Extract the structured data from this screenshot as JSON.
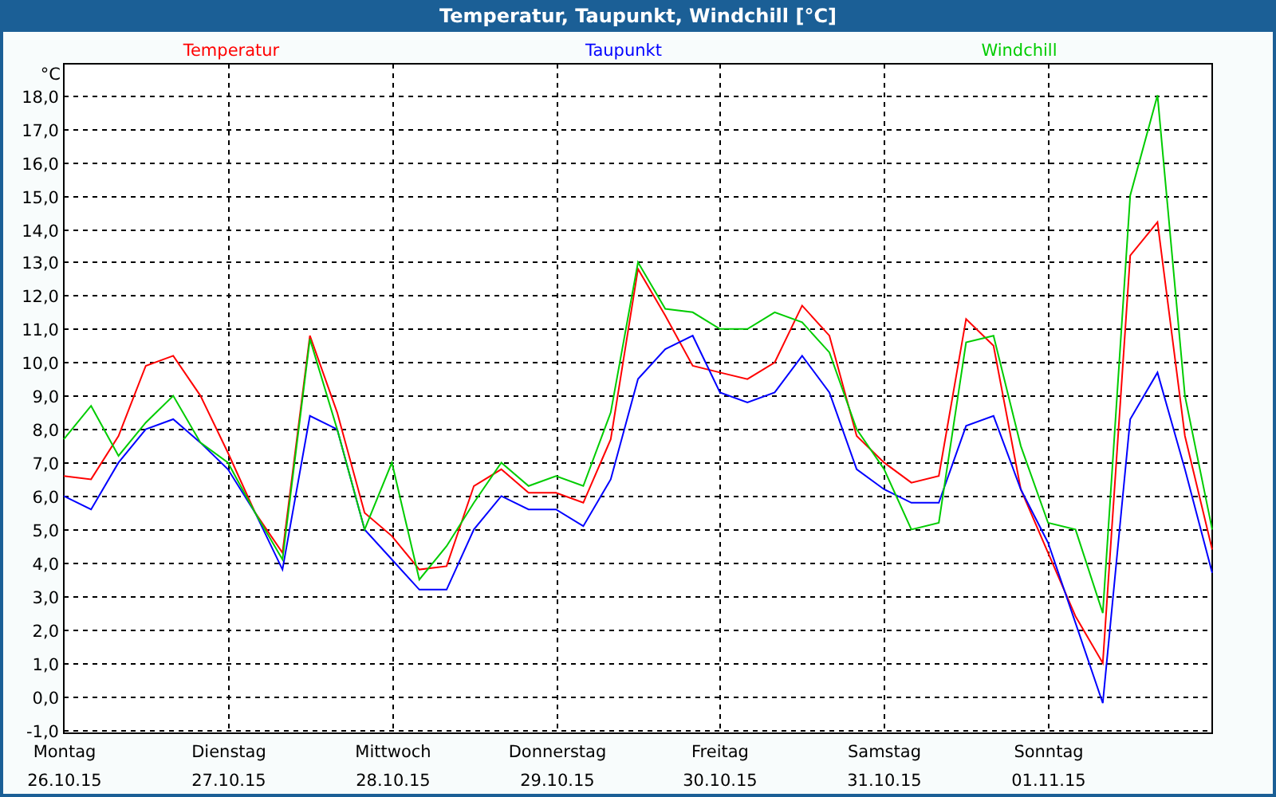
{
  "window": {
    "title": "Temperatur, Taupunkt, Windchill [°C]"
  },
  "chart": {
    "chart_data": {
      "type": "line",
      "ylabel": "°C",
      "categories": [
        "Montag",
        null,
        null,
        null,
        null,
        null,
        "Dienstag",
        null,
        null,
        null,
        null,
        null,
        "Mittwoch",
        null,
        null,
        null,
        null,
        null,
        "Donnerstag",
        null,
        null,
        null,
        null,
        null,
        "Freitag",
        null,
        null,
        null,
        null,
        null,
        "Samstag",
        null,
        null,
        null,
        null,
        null,
        "Sonntag",
        null,
        null,
        null,
        null,
        null,
        null
      ],
      "ylim": [
        -1.1,
        18.94
      ],
      "grid": true,
      "yticks": [
        {
          "value": -1,
          "label": "-1,0"
        },
        {
          "value": 0,
          "label": "0,0"
        },
        {
          "value": 1,
          "label": "1,0"
        },
        {
          "value": 2,
          "label": "2,0"
        },
        {
          "value": 3,
          "label": "3,0"
        },
        {
          "value": 4,
          "label": "4,0"
        },
        {
          "value": 5,
          "label": "5,0"
        },
        {
          "value": 6,
          "label": "6,0"
        },
        {
          "value": 7,
          "label": "7,0"
        },
        {
          "value": 8,
          "label": "8,0"
        },
        {
          "value": 9,
          "label": "9,0"
        },
        {
          "value": 10,
          "label": "10,0"
        },
        {
          "value": 11,
          "label": "11,0"
        },
        {
          "value": 12,
          "label": "12,0"
        },
        {
          "value": 13,
          "label": "13,0"
        },
        {
          "value": 14,
          "label": "14,0"
        },
        {
          "value": 15,
          "label": "15,0"
        },
        {
          "value": 16,
          "label": "16,0"
        },
        {
          "value": 17,
          "label": "17,0"
        },
        {
          "value": 18,
          "label": "18,0"
        }
      ],
      "series": [
        {
          "name": "Temperatur",
          "color": "#ff0000",
          "values": [
            6.6,
            6.5,
            7.8,
            9.9,
            10.2,
            9.0,
            7.3,
            5.5,
            4.3,
            10.8,
            8.5,
            5.5,
            4.8,
            3.8,
            3.9,
            6.3,
            6.8,
            6.1,
            6.1,
            5.8,
            7.7,
            12.8,
            11.4,
            9.9,
            9.7,
            9.5,
            10.0,
            11.7,
            10.8,
            7.8,
            7.0,
            6.4,
            6.6,
            11.3,
            10.5,
            6.2,
            4.3,
            2.4,
            1.0,
            13.2,
            14.2,
            7.8,
            4.4
          ]
        },
        {
          "name": "Taupunkt",
          "color": "#0000ff",
          "values": [
            6.0,
            5.6,
            7.0,
            8.0,
            8.3,
            7.6,
            6.8,
            5.5,
            3.8,
            8.4,
            8.0,
            5.0,
            4.1,
            3.2,
            3.2,
            5.0,
            6.0,
            5.6,
            5.6,
            5.1,
            6.5,
            9.5,
            10.4,
            10.8,
            9.1,
            8.8,
            9.1,
            10.2,
            9.1,
            6.8,
            6.2,
            5.8,
            5.8,
            8.1,
            8.4,
            6.2,
            4.6,
            2.2,
            -0.2,
            8.3,
            9.7,
            6.8,
            3.7
          ]
        },
        {
          "name": "Windchill",
          "color": "#00cc00",
          "values": [
            7.7,
            8.7,
            7.2,
            8.2,
            9.0,
            7.6,
            7.0,
            5.5,
            4.1,
            10.7,
            8.0,
            5.0,
            7.0,
            3.5,
            4.5,
            5.8,
            7.0,
            6.3,
            6.6,
            6.3,
            8.5,
            13.0,
            11.6,
            11.5,
            11.0,
            11.0,
            11.5,
            11.2,
            10.3,
            8.0,
            6.8,
            5.0,
            5.2,
            10.6,
            10.8,
            7.5,
            5.2,
            5.0,
            2.5,
            15.0,
            18.0,
            9.0,
            5.0
          ]
        }
      ]
    },
    "dates": [
      "26.10.15",
      "27.10.15",
      "28.10.15",
      "29.10.15",
      "30.10.15",
      "31.10.15",
      "01.11.15"
    ]
  }
}
